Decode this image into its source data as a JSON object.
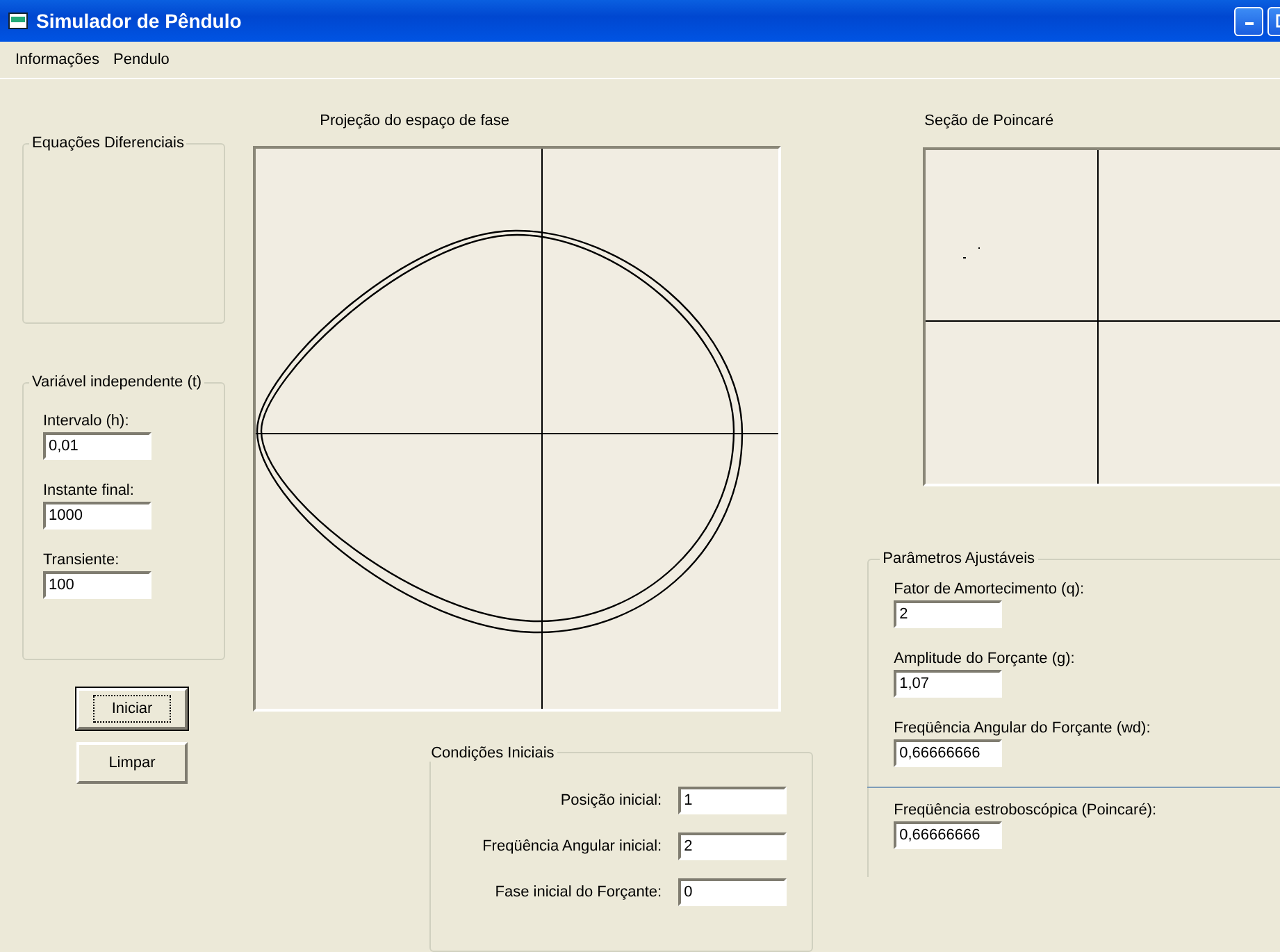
{
  "window": {
    "title": "Simulador de Pêndulo"
  },
  "menu": [
    "Informações",
    "Pendulo"
  ],
  "equations_group": {
    "title": "Equações Diferenciais"
  },
  "time_group": {
    "title": "Variável independente (t)",
    "fields": [
      {
        "label": "Intervalo (h):",
        "value": "0,01"
      },
      {
        "label": "Instante final:",
        "value": "1000"
      },
      {
        "label": "Transiente:",
        "value": "100"
      }
    ]
  },
  "buttons": [
    {
      "label": "Iniciar",
      "focused": true
    },
    {
      "label": "Limpar",
      "focused": false
    }
  ],
  "phase_plot": {
    "title": "Projeção do espaço de fase"
  },
  "initial_conditions": {
    "title": "Condições Iniciais",
    "fields": [
      {
        "label": "Posição inicial:",
        "value": "1"
      },
      {
        "label": "Freqüência Angular inicial:",
        "value": "2"
      },
      {
        "label": "Fase inicial do Forçante:",
        "value": "0"
      }
    ]
  },
  "poincare_plot": {
    "title": "Seção de Poincaré"
  },
  "parameters": {
    "title": "Parâmetros Ajustáveis",
    "fields": [
      {
        "label": "Fator de Amortecimento (q):",
        "value": "2"
      },
      {
        "label": "Amplitude do Forçante (g):",
        "value": "1,07"
      },
      {
        "label": "Freqüência Angular do Forçante (wd):",
        "value": "0,66666666"
      }
    ]
  },
  "stroboscopic": {
    "label": "Freqüência estroboscópica (Poincaré):",
    "value": "0,66666666"
  }
}
